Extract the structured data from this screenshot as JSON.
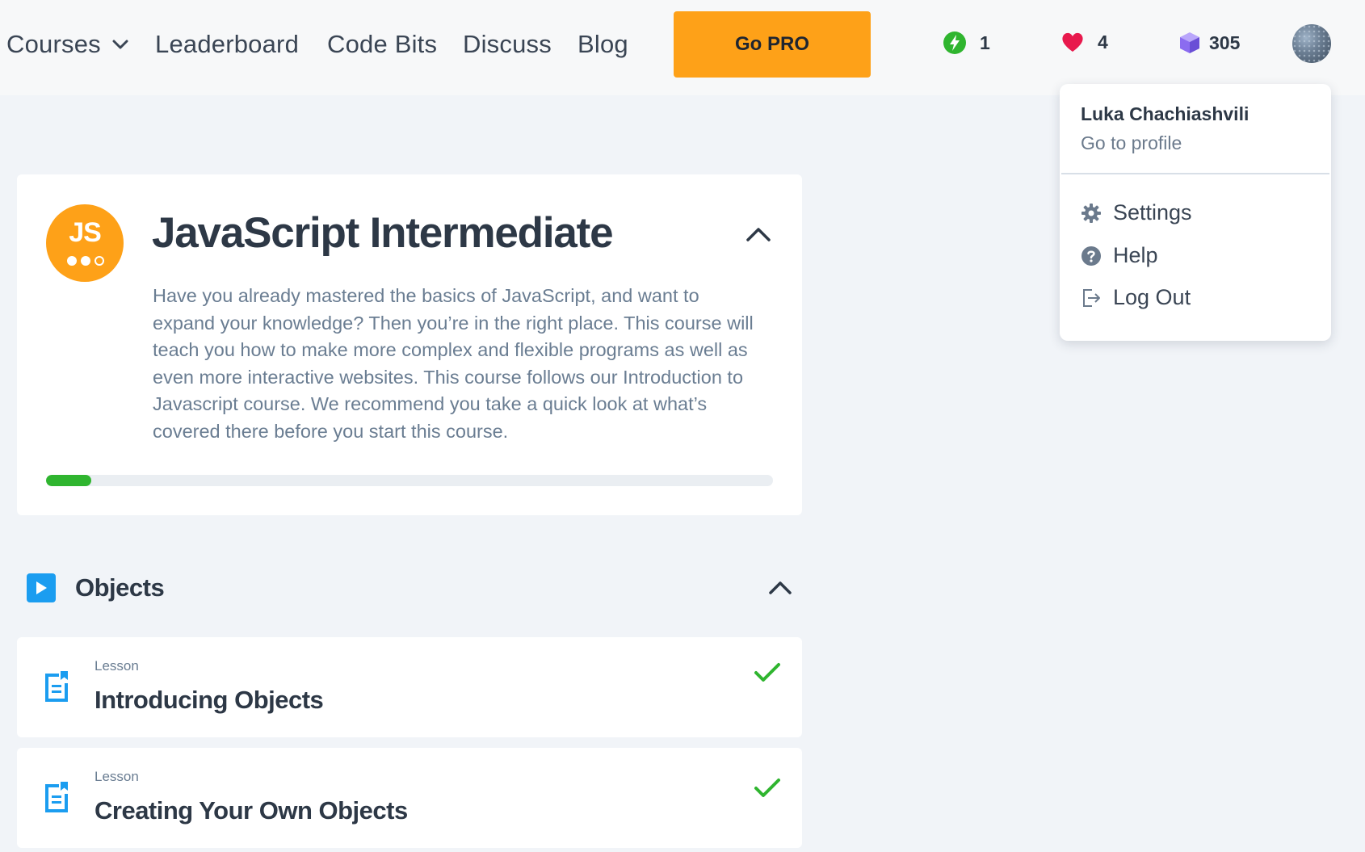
{
  "nav": {
    "courses_label": "Courses",
    "leaderboard_label": "Leaderboard",
    "codebits_label": "Code Bits",
    "discuss_label": "Discuss",
    "blog_label": "Blog",
    "gopro_label": "Go PRO"
  },
  "stats": {
    "streak": "1",
    "hearts": "4",
    "bits": "305"
  },
  "user_menu": {
    "name": "Luka Chachiashvili",
    "profile_link": "Go to profile",
    "items": [
      {
        "label": "Settings",
        "icon": "gear-icon"
      },
      {
        "label": "Help",
        "icon": "question-circle-icon"
      },
      {
        "label": "Log Out",
        "icon": "logout-icon"
      }
    ]
  },
  "course": {
    "badge_text": "JS",
    "title": "JavaScript Intermediate",
    "description": "Have you already mastered the basics of JavaScript, and want to expand your knowledge? Then you’re in the right place. This course will teach you how to make more complex and flexible programs as well as even more interactive websites. This course follows our Introduction to Javascript course. We recommend you take a quick look at what’s covered there before you start this course.",
    "progress_fraction": 0.062
  },
  "section": {
    "title": "Objects"
  },
  "lessons": [
    {
      "type": "Lesson",
      "title": "Introducing Objects",
      "completed": true
    },
    {
      "type": "Lesson",
      "title": "Creating Your Own Objects",
      "completed": true
    }
  ],
  "colors": {
    "accent_orange": "#fea118",
    "success_green": "#2fb52f",
    "section_blue": "#1b9df0",
    "heart_red": "#e8194d",
    "bits_purple": "#8b6cf0"
  }
}
